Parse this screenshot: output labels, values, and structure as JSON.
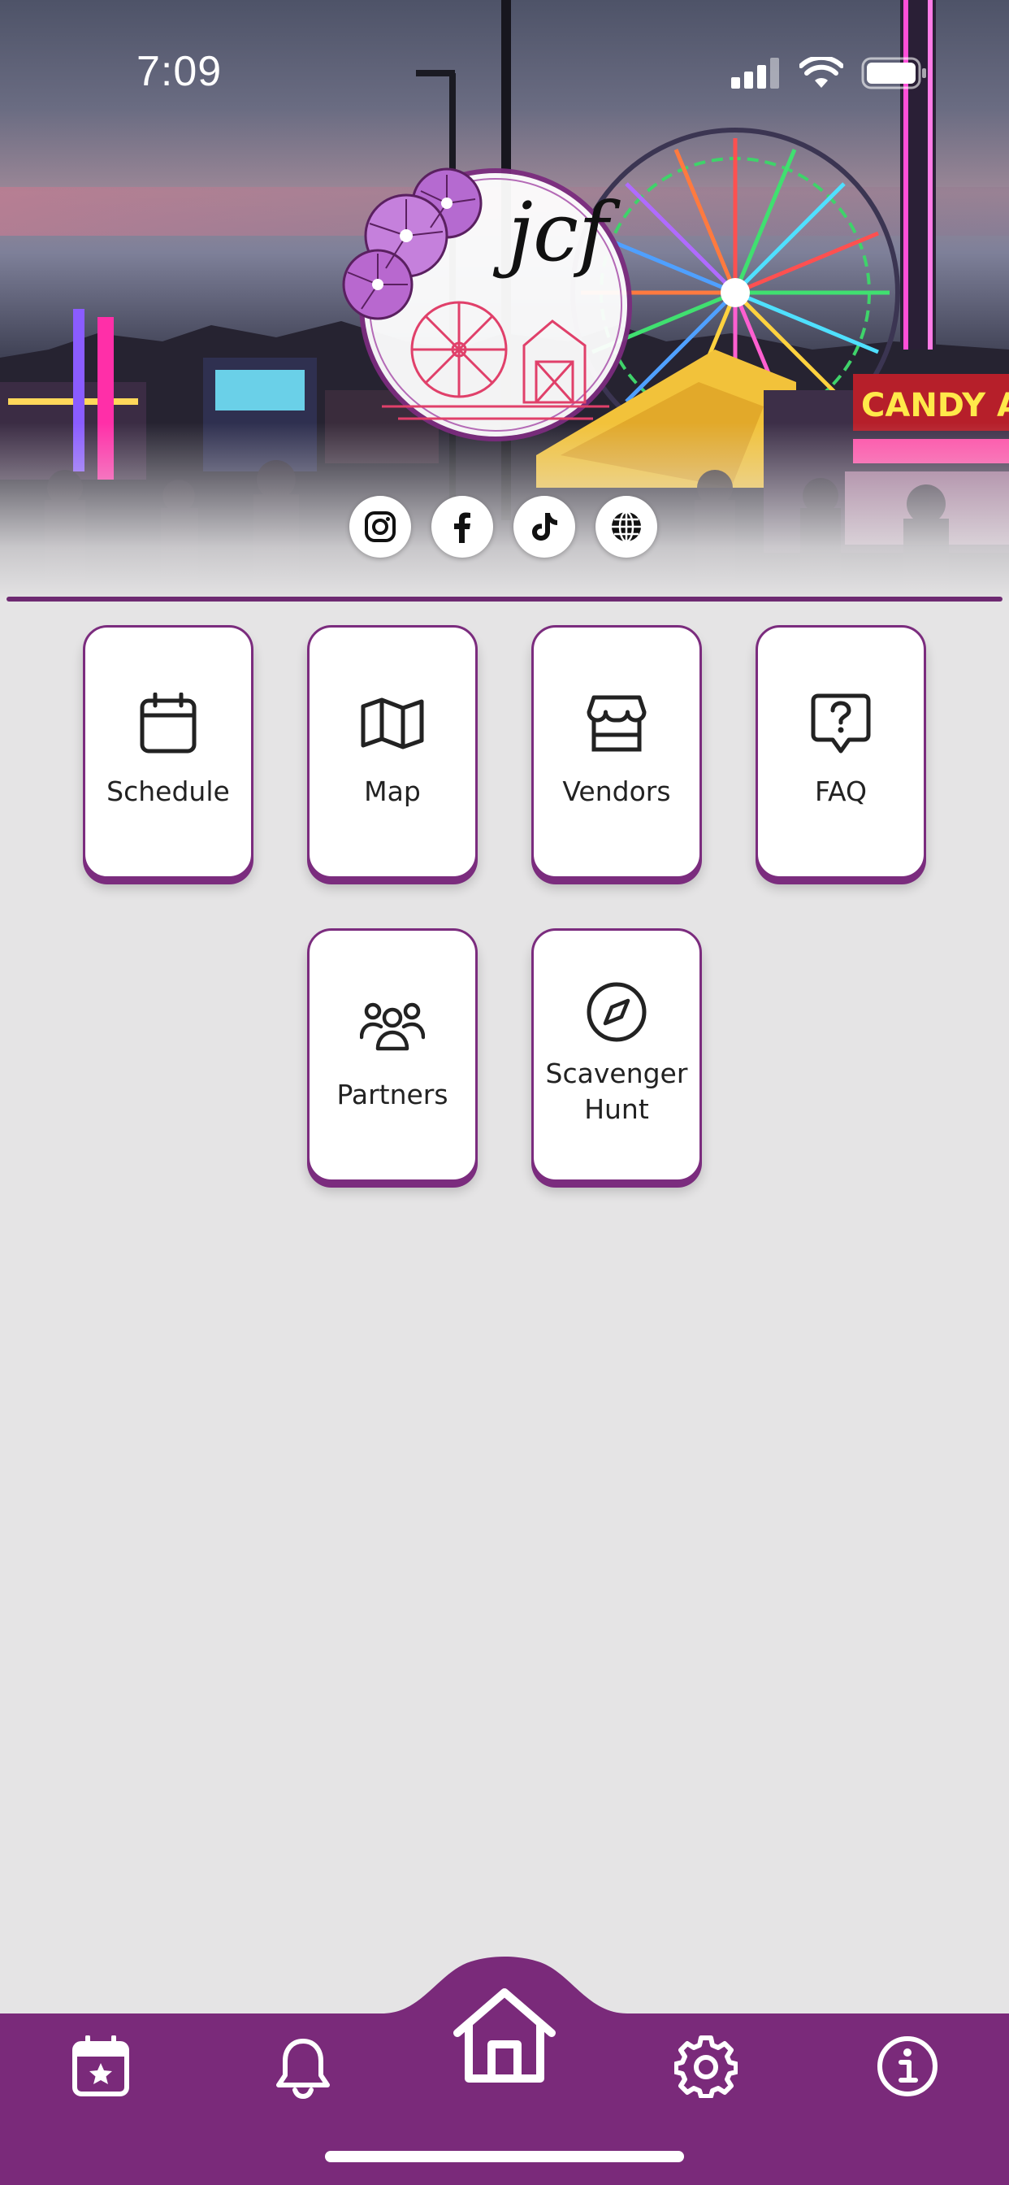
{
  "status_bar": {
    "time": "7:09",
    "icons": [
      "cellular-signal-icon",
      "wifi-icon",
      "battery-icon"
    ]
  },
  "header": {
    "logo_text": "jcf",
    "social_links": [
      {
        "name": "instagram",
        "icon": "instagram-icon"
      },
      {
        "name": "facebook",
        "icon": "facebook-icon"
      },
      {
        "name": "tiktok",
        "icon": "tiktok-icon"
      },
      {
        "name": "website",
        "icon": "globe-icon"
      }
    ]
  },
  "menu": {
    "tiles": [
      {
        "label": "Schedule",
        "icon": "calendar-icon"
      },
      {
        "label": "Map",
        "icon": "map-icon"
      },
      {
        "label": "Vendors",
        "icon": "storefront-icon"
      },
      {
        "label": "FAQ",
        "icon": "question-bubble-icon"
      },
      {
        "label": "Partners",
        "icon": "people-icon"
      },
      {
        "label": "Scavenger Hunt",
        "icon": "compass-icon"
      }
    ]
  },
  "bottom_nav": {
    "items": [
      {
        "name": "events",
        "icon": "calendar-star-icon"
      },
      {
        "name": "notifications",
        "icon": "bell-icon"
      },
      {
        "name": "home",
        "icon": "home-icon",
        "active": true
      },
      {
        "name": "settings",
        "icon": "gear-icon"
      },
      {
        "name": "info",
        "icon": "info-icon"
      }
    ]
  },
  "colors": {
    "brand_purple": "#7a2a7a",
    "tile_border": "#7b2c7e",
    "background": "#e5e4e5"
  }
}
